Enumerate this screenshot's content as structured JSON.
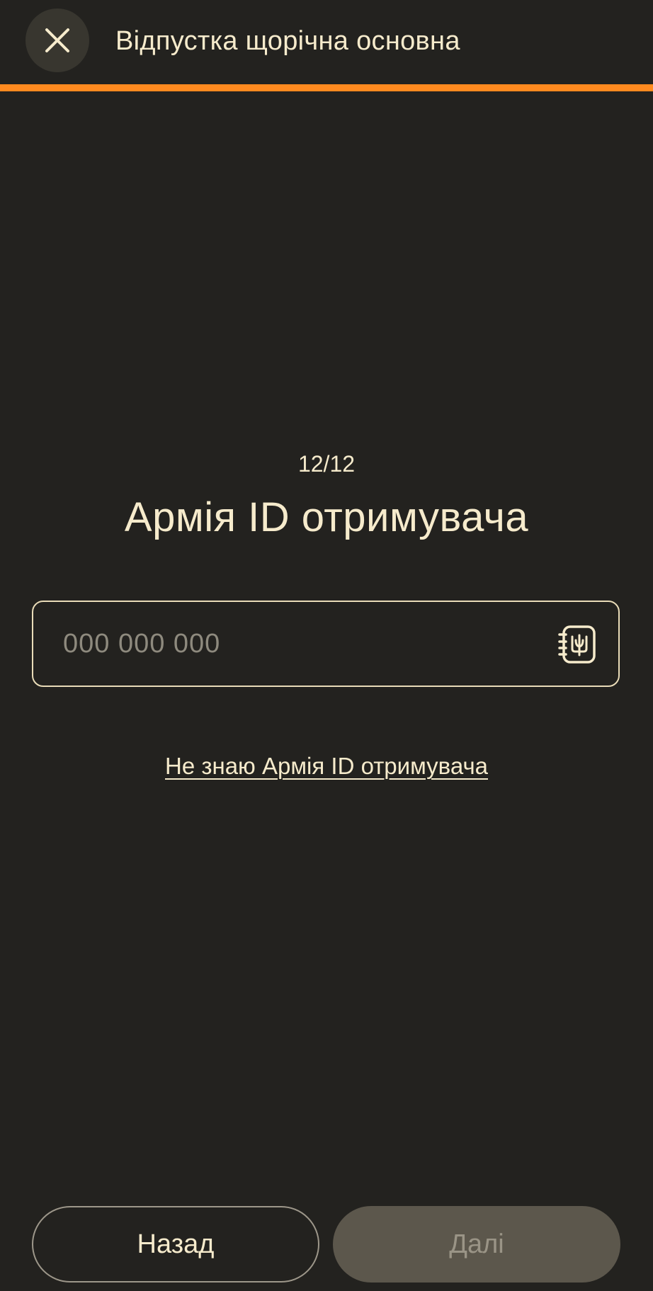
{
  "header": {
    "title": "Відпустка щорічна основна",
    "close_icon": "close-icon"
  },
  "progress": {
    "fraction": 1.0,
    "color": "#ff8a1f"
  },
  "step": {
    "counter": "12/12"
  },
  "main": {
    "title": "Армія ID отримувача",
    "army_id_field": {
      "value": "",
      "placeholder": "000 000 000",
      "icon": "army-id-card-icon"
    },
    "dont_know_link": "Не знаю Армія ID отримувача"
  },
  "footer": {
    "back_label": "Назад",
    "next_label": "Далі"
  },
  "colors": {
    "background": "#23221f",
    "text": "#f6ebcc",
    "accent": "#ff8a1f",
    "disabled_button": "#5c574c"
  }
}
